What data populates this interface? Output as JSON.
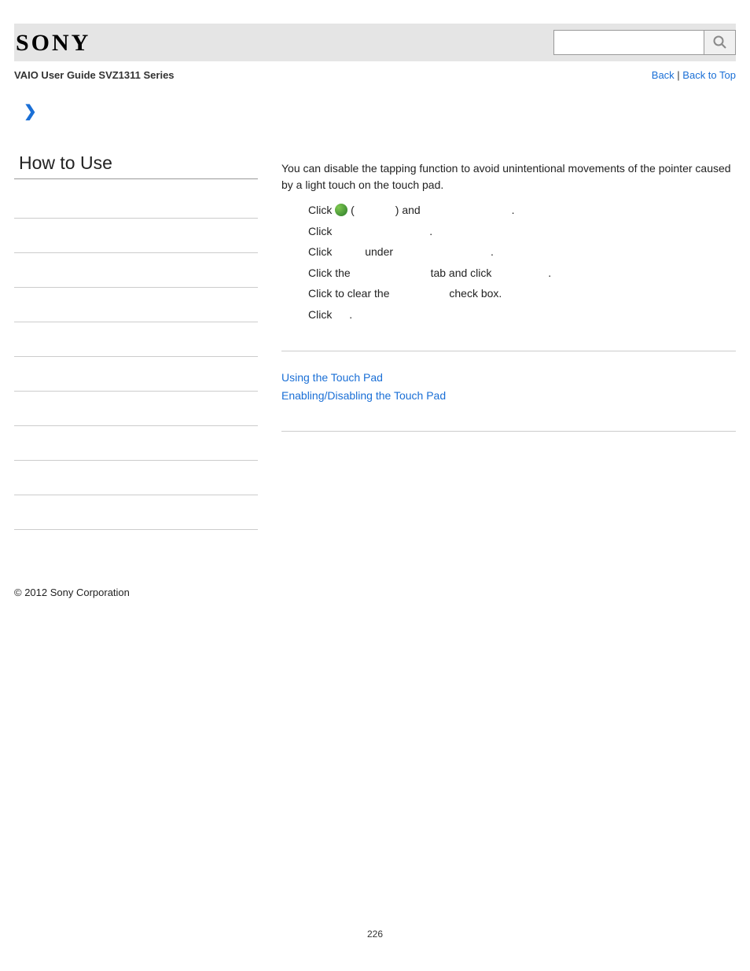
{
  "header": {
    "logo": "SONY",
    "search_placeholder": ""
  },
  "topnav": {
    "guide_title": "VAIO User Guide SVZ1311 Series",
    "back": "Back",
    "sep": " | ",
    "back_top": "Back to Top"
  },
  "sidebar": {
    "title": "How to Use"
  },
  "content": {
    "intro": "You can disable the tapping function to avoid unintentional movements of the pointer caused by a light touch on the touch pad.",
    "steps": {
      "s1a": "Click ",
      "s1b": " (",
      "s1c": ") and ",
      "s1d": ".",
      "s2a": "Click ",
      "s2b": ".",
      "s3a": "Click ",
      "s3b": "under ",
      "s3c": ".",
      "s4a": "Click the ",
      "s4b": "tab and click ",
      "s4c": ".",
      "s5a": "Click to clear the ",
      "s5b": "check box.",
      "s6a": "Click ",
      "s6b": "."
    },
    "related": {
      "link1": "Using the Touch Pad",
      "link2": "Enabling/Disabling the Touch Pad"
    }
  },
  "footer": {
    "copyright": "© 2012 Sony Corporation",
    "page": "226"
  }
}
